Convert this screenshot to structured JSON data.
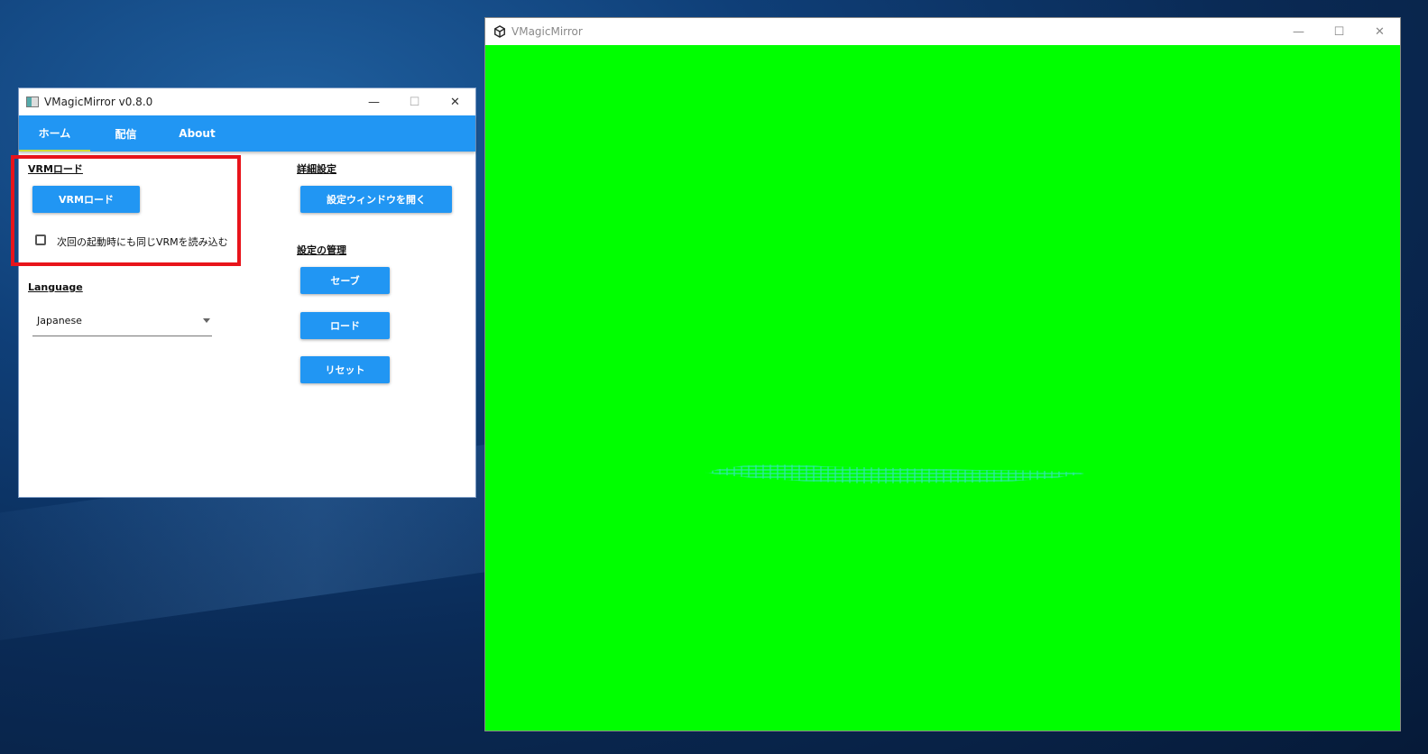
{
  "control_window": {
    "title": "VMagicMirror v0.8.0",
    "controls": {
      "minimize": "—",
      "maximize": "☐",
      "close": "✕"
    },
    "tabs": [
      {
        "label": "ホーム",
        "active": true
      },
      {
        "label": "配信",
        "active": false
      },
      {
        "label": "About",
        "active": false
      }
    ],
    "vrm_section": {
      "heading": "VRMロード",
      "load_button": "VRMロード",
      "autoload_checkbox_label": "次回の起動時にも同じVRMを読み込む",
      "autoload_checked": false
    },
    "language_section": {
      "heading": "Language",
      "selected": "Japanese"
    },
    "advanced_section": {
      "heading": "詳細設定",
      "open_settings_button": "設定ウィンドウを開く"
    },
    "settings_management": {
      "heading": "設定の管理",
      "save_button": "セーブ",
      "load_button": "ロード",
      "reset_button": "リセット"
    }
  },
  "render_window": {
    "title": "VMagicMirror",
    "controls": {
      "minimize": "—",
      "maximize": "☐",
      "close": "✕"
    },
    "background_color": "#00ff00"
  },
  "colors": {
    "accent": "#2196f3",
    "tab_indicator": "#cddc39",
    "highlight": "#e8141b"
  }
}
